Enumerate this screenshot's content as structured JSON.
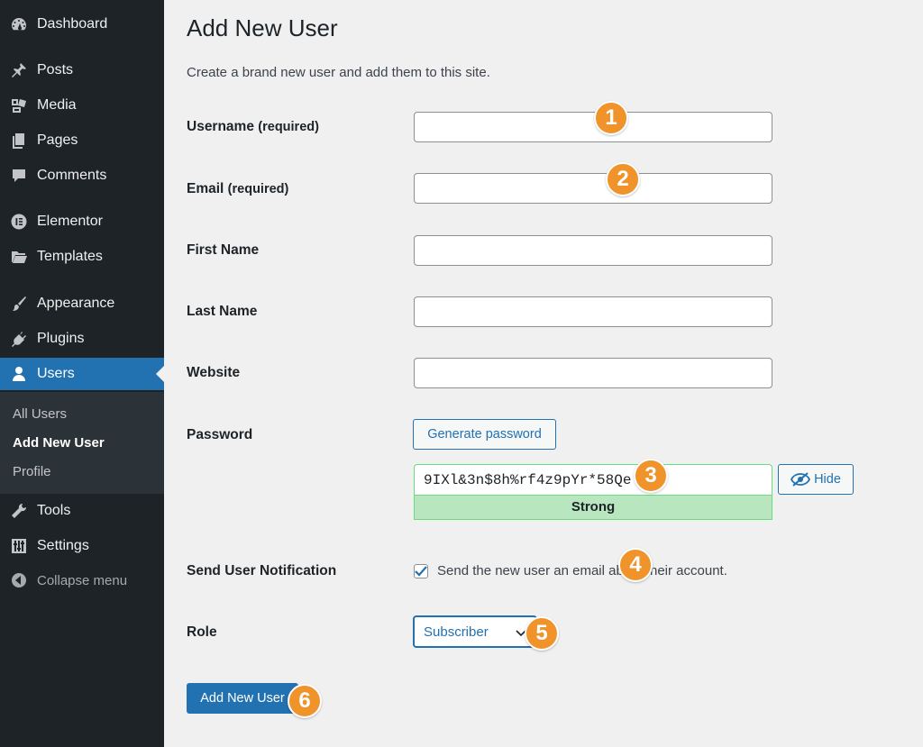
{
  "sidebar": {
    "items": [
      {
        "label": "Dashboard",
        "icon": "dashboard-icon"
      },
      {
        "label": "Posts",
        "icon": "pin-icon"
      },
      {
        "label": "Media",
        "icon": "media-icon"
      },
      {
        "label": "Pages",
        "icon": "pages-icon"
      },
      {
        "label": "Comments",
        "icon": "comment-icon"
      },
      {
        "label": "Elementor",
        "icon": "elementor-icon"
      },
      {
        "label": "Templates",
        "icon": "folder-icon"
      },
      {
        "label": "Appearance",
        "icon": "brush-icon"
      },
      {
        "label": "Plugins",
        "icon": "plug-icon"
      },
      {
        "label": "Users",
        "icon": "user-icon"
      },
      {
        "label": "Tools",
        "icon": "wrench-icon"
      },
      {
        "label": "Settings",
        "icon": "sliders-icon"
      },
      {
        "label": "Collapse menu",
        "icon": "collapse-icon"
      }
    ],
    "submenu": [
      "All Users",
      "Add New User",
      "Profile"
    ]
  },
  "page": {
    "title": "Add New User",
    "description": "Create a brand new user and add them to this site."
  },
  "form": {
    "username_label": "Username",
    "email_label": "Email",
    "required_suffix": "(required)",
    "first_name_label": "First Name",
    "last_name_label": "Last Name",
    "website_label": "Website",
    "password_label": "Password",
    "generate_password": "Generate password",
    "password_value": "9IXl&3n$8h%rf4z9pYr*58Qe",
    "hide_label": "Hide",
    "strength": "Strong",
    "notification_label": "Send User Notification",
    "notification_text": "Send the new user an email about their account.",
    "notification_checked": true,
    "role_label": "Role",
    "role_value": "Subscriber",
    "submit_label": "Add New User"
  },
  "annotations": [
    "1",
    "2",
    "3",
    "4",
    "5",
    "6"
  ],
  "colors": {
    "sidebar_bg": "#1d2327",
    "accent": "#2271b1",
    "badge": "#f0932b",
    "strength_bg": "#b8e6bf"
  }
}
